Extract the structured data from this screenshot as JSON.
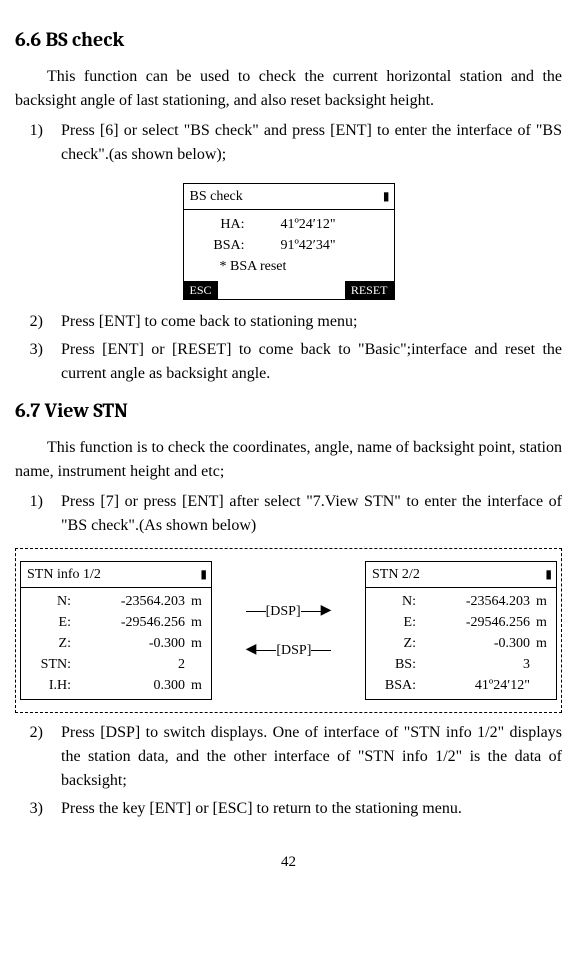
{
  "page_number": "42",
  "sec66": {
    "heading": "6.6 BS check",
    "para": "This function can be used to check the current horizontal station and the backsight angle of last stationing, and also reset backsight height.",
    "step1": "Press [6] or select \"BS check\" and press [ENT] to enter the interface of \"BS check\".(as shown below);",
    "step2": "Press [ENT] to come back to stationing menu;",
    "step3": "Press [ENT] or [RESET] to come back to \"Basic\";interface and reset the current angle as backsight angle."
  },
  "bs_screen": {
    "title": "BS check",
    "ha_label": "HA:",
    "ha_val": "41º24′12\"",
    "bsa_label": "BSA:",
    "bsa_val": "91º42′34\"",
    "note": "* BSA reset",
    "esc": "ESC",
    "reset": "RESET"
  },
  "sec67": {
    "heading": "6.7 View STN",
    "para": "This function is to check the coordinates, angle, name of backsight point, station name, instrument height and etc;",
    "step1": "Press [7] or press [ENT] after select \"7.View STN\" to enter the interface of \"BS check\".(As shown below)",
    "step2": "Press [DSP] to switch displays. One of interface of \"STN info 1/2\" displays the station data, and the other interface of \"STN info 1/2\" is the data of backsight;",
    "step3": "Press the key [ENT] or [ESC] to return to the stationing menu."
  },
  "dsp_label": "[DSP]",
  "stn1": {
    "title": "STN info 1/2",
    "rows": [
      {
        "label": "N:",
        "val": "-23564.203",
        "unit": "m"
      },
      {
        "label": "E:",
        "val": "-29546.256",
        "unit": "m"
      },
      {
        "label": "Z:",
        "val": "-0.300",
        "unit": "m"
      },
      {
        "label": "STN:",
        "val": "2",
        "unit": ""
      },
      {
        "label": "I.H:",
        "val": "0.300",
        "unit": "m"
      }
    ]
  },
  "stn2": {
    "title": "STN 2/2",
    "rows": [
      {
        "label": "N:",
        "val": "-23564.203",
        "unit": "m"
      },
      {
        "label": "E:",
        "val": "-29546.256",
        "unit": "m"
      },
      {
        "label": "Z:",
        "val": "-0.300",
        "unit": "m"
      },
      {
        "label": "BS:",
        "val": "3",
        "unit": ""
      },
      {
        "label": "BSA:",
        "val": "41º24′12\"",
        "unit": ""
      }
    ]
  }
}
